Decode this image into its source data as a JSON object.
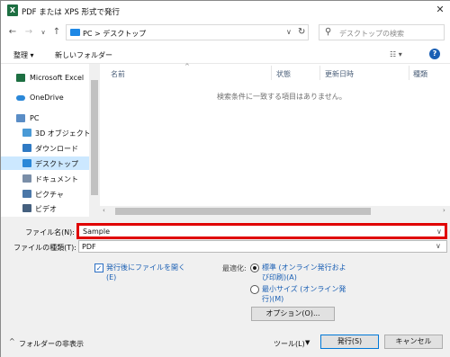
{
  "window": {
    "title": "PDF または XPS 形式で発行",
    "app_logo": "X"
  },
  "titlebar": {
    "close_glyph": "✕"
  },
  "nav": {
    "back_glyph": "←",
    "forward_glyph": "→",
    "dropdown_glyph": "∨",
    "up_glyph": "↑",
    "refresh_glyph": "↻"
  },
  "address": {
    "path": "PC  >  デスクトップ",
    "chevron_glyph": "∨"
  },
  "search": {
    "placeholder": "デスクトップの検索",
    "icon_glyph": "⚲"
  },
  "toolbar": {
    "organize": "整理 ▾",
    "new_folder": "新しいフォルダー",
    "view_glyph": "☷ ▾",
    "help_glyph": "?"
  },
  "sidebar": {
    "items": [
      {
        "label": "Microsoft Excel",
        "icon": "excel-icon",
        "color": "#1d6f42"
      },
      {
        "label": "OneDrive",
        "icon": "cloud-icon",
        "color": "#2b88d8"
      },
      {
        "label": "PC",
        "icon": "computer-icon",
        "color": "#5a8dc6"
      },
      {
        "label": "3D オブジェクト",
        "icon": "cube-icon",
        "color": "#4a9ad6"
      },
      {
        "label": "ダウンロード",
        "icon": "download-icon",
        "color": "#2f7ac4"
      },
      {
        "label": "デスクトップ",
        "icon": "desktop-icon",
        "color": "#2b88d8"
      },
      {
        "label": "ドキュメント",
        "icon": "document-icon",
        "color": "#7a8ea8"
      },
      {
        "label": "ピクチャ",
        "icon": "picture-icon",
        "color": "#4b77a8"
      },
      {
        "label": "ビデオ",
        "icon": "video-icon",
        "color": "#45607f"
      }
    ],
    "selected": "デスクトップ"
  },
  "filelist": {
    "columns": [
      "名前",
      "状態",
      "更新日時",
      "種類"
    ],
    "empty_message": "検索条件に一致する項目はありません。"
  },
  "form": {
    "filename_label": "ファイル名(N):",
    "filename_value": "Sample",
    "filetype_label": "ファイルの種類(T):",
    "filetype_value": "PDF",
    "open_after_label": "発行後にファイルを開く\n(E)",
    "optimize_label": "最適化:",
    "opt_standard": "標準 (オンライン発行およ\nび印刷)(A)",
    "opt_minimum": "最小サイズ (オンライン発\n行)(M)",
    "options_button": "オプション(O)..."
  },
  "footer": {
    "hide_folders": "フォルダーの非表示",
    "tools": "ツール(L)",
    "publish": "発行(S)",
    "cancel": "キャンセル"
  },
  "colors": {
    "highlight_border": "#e00000",
    "accent": "#0078d7",
    "selected_bg": "#cce8ff"
  }
}
